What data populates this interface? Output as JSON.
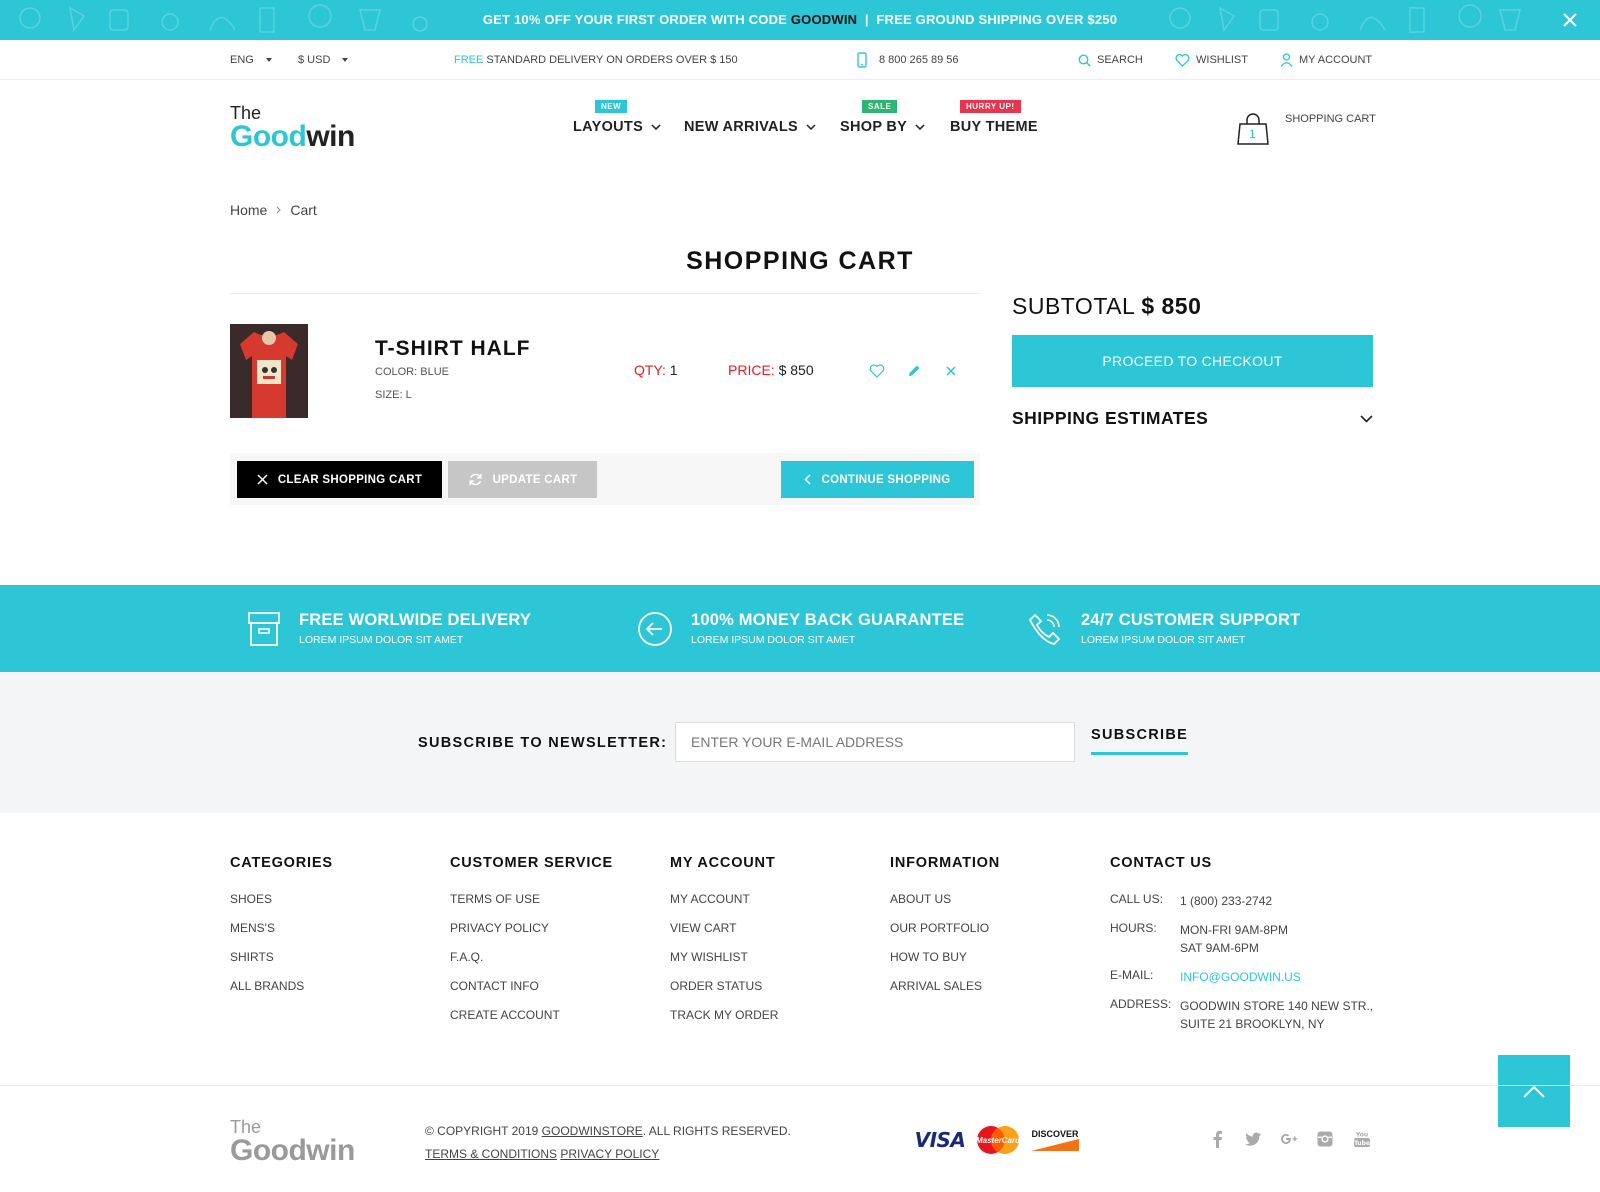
{
  "promo": {
    "part1": "GET 10% OFF YOUR FIRST ORDER WITH CODE ",
    "code": "GOODWIN",
    "separator": "  |  ",
    "part2": "FREE GROUND SHIPPING OVER $250"
  },
  "topbar": {
    "language": "ENG",
    "currency": "$ USD",
    "delivery_free": "FREE",
    "delivery_rest": " STANDARD DELIVERY ON ORDERS OVER $ 150",
    "phone": "8 800 265 89 56",
    "search": "SEARCH",
    "wishlist": "WISHLIST",
    "account": "MY ACCOUNT"
  },
  "logo": {
    "the": "The",
    "good": "Good",
    "win": "win"
  },
  "nav": {
    "items": [
      {
        "label": "LAYOUTS",
        "badge": "NEW"
      },
      {
        "label": "NEW ARRIVALS",
        "badge": ""
      },
      {
        "label": "SHOP BY",
        "badge": "SALE"
      },
      {
        "label": "BUY THEME",
        "badge": "HURRY UP!"
      }
    ],
    "cart_label": "SHOPPING CART",
    "cart_count": "1"
  },
  "breadcrumb": {
    "home": "Home",
    "current": "Cart"
  },
  "page_title": "SHOPPING CART",
  "cart": {
    "items": [
      {
        "name": "T-SHIRT HALF",
        "color_label": "COLOR:",
        "color": "BLUE",
        "size_label": "SIZE:",
        "size": "L",
        "qty_label": "QTY:",
        "qty": "1",
        "price_label": "PRICE:",
        "price": "$ 850"
      }
    ],
    "clear_button": "CLEAR SHOPPING CART",
    "update_button": "UPDATE CART",
    "continue_button": "CONTINUE SHOPPING"
  },
  "summary": {
    "subtotal_label": "SUBTOTAL",
    "subtotal_value": "$ 850",
    "checkout_button": "PROCEED TO CHECKOUT",
    "shipping_estimates": "SHIPPING ESTIMATES"
  },
  "features": [
    {
      "title": "FREE WORLWIDE DELIVERY",
      "subtitle": "LOREM IPSUM DOLOR SIT AMET",
      "icon": "box-icon"
    },
    {
      "title": "100% MONEY BACK GUARANTEE",
      "subtitle": "LOREM IPSUM DOLOR SIT AMET",
      "icon": "arrow-left-circle-icon"
    },
    {
      "title": "24/7 CUSTOMER SUPPORT",
      "subtitle": "LOREM IPSUM DOLOR SIT AMET",
      "icon": "phone-icon"
    }
  ],
  "newsletter": {
    "label": "SUBSCRIBE TO NEWSLETTER:",
    "placeholder": "ENTER YOUR E-MAIL ADDRESS",
    "button": "SUBSCRIBE"
  },
  "footer": {
    "categories": {
      "title": "CATEGORIES",
      "links": [
        "SHOES",
        "MENS'S",
        "SHIRTS",
        "ALL BRANDS"
      ]
    },
    "customer_service": {
      "title": "CUSTOMER SERVICE",
      "links": [
        "TERMS OF USE",
        "PRIVACY POLICY",
        "F.A.Q.",
        "CONTACT INFO",
        "CREATE ACCOUNT"
      ]
    },
    "my_account": {
      "title": "MY ACCOUNT",
      "links": [
        "MY ACCOUNT",
        "VIEW CART",
        "MY WISHLIST",
        "ORDER STATUS",
        "TRACK MY ORDER"
      ]
    },
    "information": {
      "title": "INFORMATION",
      "links": [
        "ABOUT US",
        "OUR PORTFOLIO",
        "HOW TO BUY",
        "ARRIVAL SALES"
      ]
    },
    "contact": {
      "title": "CONTACT US",
      "call_label": "CALL US:",
      "call": "1 (800) 233-2742",
      "hours_label": "HOURS:",
      "hours1": "MON-FRI 9AM-8PM",
      "hours2": "SAT 9AM-6PM",
      "email_label": "E-MAIL:",
      "email": "INFO@GOODWIN.US",
      "address_label": "ADDRESS:",
      "address1": "GOODWIN STORE 140 NEW STR.,",
      "address2": "SUITE 21 BROOKLYN, NY"
    }
  },
  "bottom": {
    "logo_the": "The",
    "logo_name": "Goodwin",
    "copyright_pre": "© COPYRIGHT 2019 ",
    "copyright_link": "GOODWINSTORE",
    "copyright_post": ". ALL RIGHTS RESERVED.",
    "terms": "TERMS & CONDITIONS",
    "privacy": "PRIVACY POLICY",
    "payments": [
      "VISA",
      "MasterCard",
      "DISCOVER"
    ],
    "social": [
      "facebook-icon",
      "twitter-icon",
      "google-plus-icon",
      "instagram-icon",
      "youtube-icon"
    ]
  },
  "colors": {
    "accent": "#2cc6d6",
    "price_red": "#e02121",
    "badge_sale": "#2bb673",
    "badge_hurry": "#e8344e"
  }
}
